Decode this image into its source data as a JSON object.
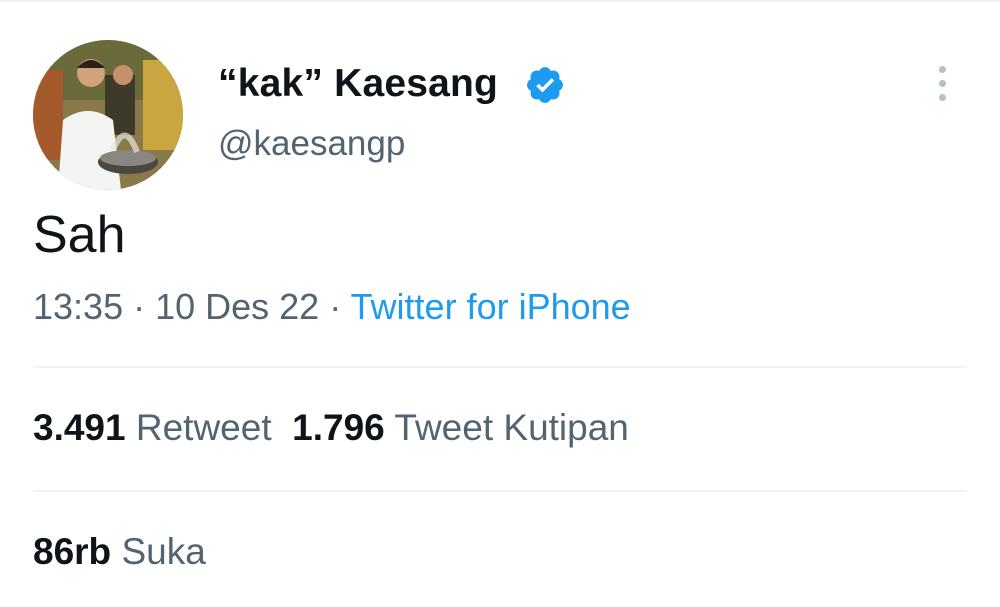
{
  "tweet": {
    "author": {
      "display_name": "“kak” Kaesang",
      "handle": "@kaesangp",
      "verified_icon": "verified-badge-icon",
      "avatar": "avatar"
    },
    "text": "Sah",
    "meta": {
      "time": "13:35",
      "separator": " · ",
      "date": "10 Des 22",
      "source": "Twitter for iPhone"
    },
    "stats": {
      "retweets_count": "3.491",
      "retweets_label": "Retweet",
      "quotes_count": "1.796",
      "quotes_label": "Tweet Kutipan",
      "likes_count": "86rb",
      "likes_label": "Suka"
    },
    "menu_icon": "more-vertical-icon"
  },
  "colors": {
    "text": "#0f1419",
    "secondary": "#536471",
    "link": "#1d9bf0",
    "divider": "#eff3f4",
    "verified": "#1d9bf0"
  }
}
